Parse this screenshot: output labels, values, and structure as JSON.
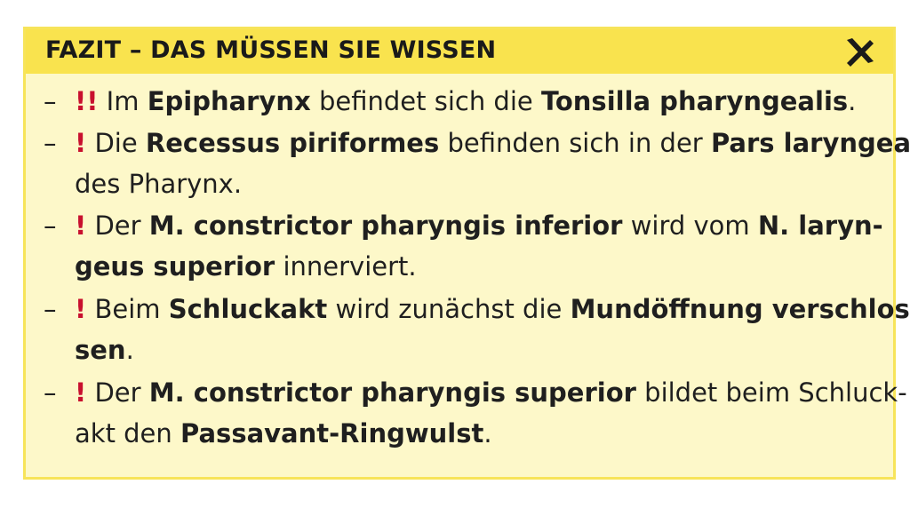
{
  "header": {
    "title": "FAZIT – DAS MÜSSEN SIE WISSEN",
    "close_icon": "close-icon"
  },
  "colors": {
    "header_bg": "#f9e34e",
    "body_bg": "#fdf8c9",
    "mark": "#c8102e"
  },
  "items": [
    {
      "dash": "–",
      "mark": "!!",
      "l1": [
        " Im ",
        "Epipharynx",
        " befindet sich die ",
        "Tonsilla pharyngealis",
        "."
      ]
    },
    {
      "dash": "–",
      "mark": "!",
      "l1": [
        " Die ",
        "Recessus piriformes",
        " befinden sich in der ",
        "Pars laryngea"
      ],
      "l2": [
        "des Pharynx."
      ]
    },
    {
      "dash": "–",
      "mark": "!",
      "l1": [
        " Der ",
        "M. constrictor pharyngis inferior",
        " wird vom ",
        "N. laryn-"
      ],
      "l2": [
        "geus superior",
        " innerviert."
      ]
    },
    {
      "dash": "–",
      "mark": "!",
      "l1": [
        " Beim ",
        "Schluckakt",
        " wird zunächst die ",
        "Mundöffnung verschlos-"
      ],
      "l2": [
        "sen",
        "."
      ]
    },
    {
      "dash": "–",
      "mark": "!",
      "l1": [
        " Der ",
        "M. constrictor pharyngis superior",
        " bildet beim Schluck-"
      ],
      "l2": [
        "akt den ",
        "Passavant-Ringwulst",
        "."
      ]
    }
  ]
}
